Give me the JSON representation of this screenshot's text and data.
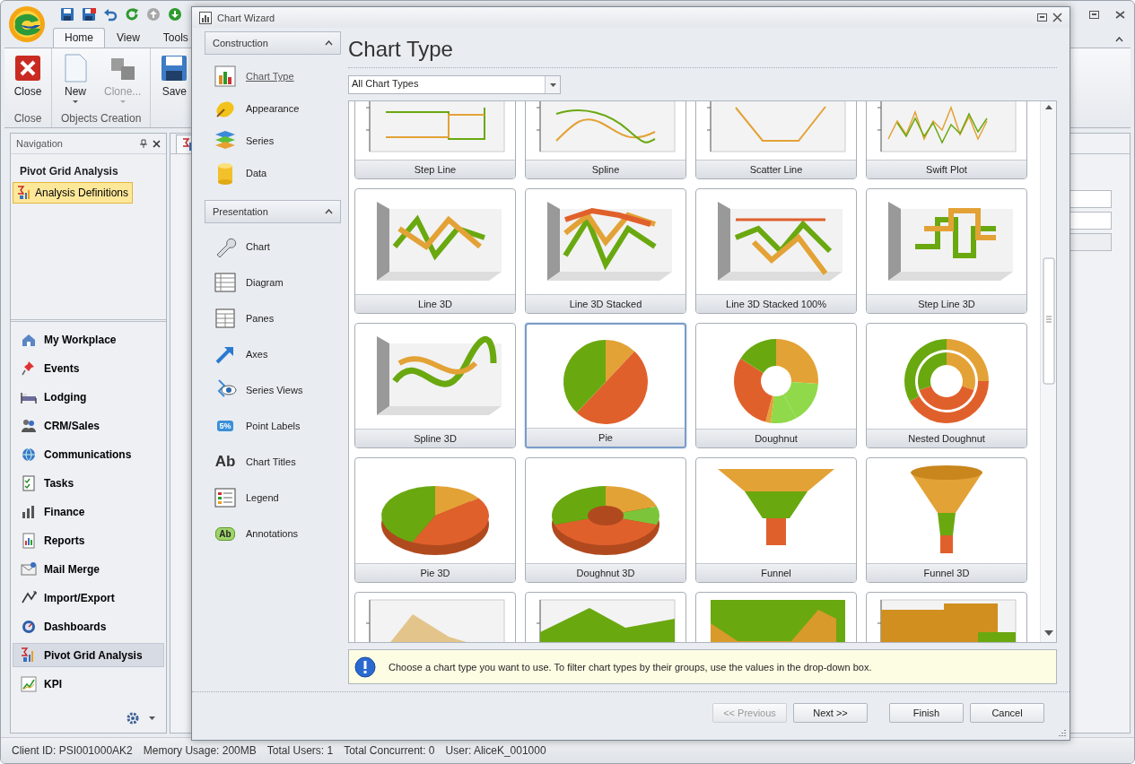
{
  "ribbon": {
    "tabs": [
      {
        "label": "Home",
        "selected": true
      },
      {
        "label": "View",
        "selected": false
      },
      {
        "label": "Tools",
        "selected": false
      }
    ],
    "groups": [
      {
        "label": "Close",
        "buttons": [
          {
            "label": "Close",
            "kind": "close",
            "disabled": false,
            "dropdown": false
          }
        ]
      },
      {
        "label": "Objects Creation",
        "buttons": [
          {
            "label": "New",
            "kind": "new",
            "disabled": false,
            "dropdown": true
          },
          {
            "label": "Clone...",
            "kind": "clone",
            "disabled": true,
            "dropdown": true
          }
        ]
      },
      {
        "buttons": [
          {
            "label": "Save",
            "kind": "save",
            "disabled": false,
            "dropdown": false
          }
        ]
      }
    ]
  },
  "navigation": {
    "title": "Navigation",
    "section": "Pivot Grid Analysis",
    "items": [
      {
        "label": "Analysis Definitions",
        "selected": true
      }
    ],
    "modules": [
      {
        "label": "My Workplace",
        "selected": false
      },
      {
        "label": "Events",
        "selected": false
      },
      {
        "label": "Lodging",
        "selected": false
      },
      {
        "label": "CRM/Sales",
        "selected": false
      },
      {
        "label": "Communications",
        "selected": false
      },
      {
        "label": "Tasks",
        "selected": false
      },
      {
        "label": "Finance",
        "selected": false
      },
      {
        "label": "Reports",
        "selected": false
      },
      {
        "label": "Mail Merge",
        "selected": false
      },
      {
        "label": "Import/Export",
        "selected": false
      },
      {
        "label": "Dashboards",
        "selected": false
      },
      {
        "label": "Pivot Grid Analysis",
        "selected": true
      },
      {
        "label": "KPI",
        "selected": false
      }
    ]
  },
  "status_bar": [
    "Client ID: PSI001000AK2",
    "Memory Usage: 200MB",
    "Total Users: 1",
    "Total Concurrent: 0",
    "User: AliceK_001000"
  ],
  "wizard": {
    "title": "Chart Wizard",
    "nav_groups": [
      {
        "title": "Construction",
        "expanded": true,
        "items": [
          {
            "label": "Chart Type",
            "selected": true
          },
          {
            "label": "Appearance",
            "selected": false
          },
          {
            "label": "Series",
            "selected": false
          },
          {
            "label": "Data",
            "selected": false
          }
        ]
      },
      {
        "title": "Presentation",
        "expanded": true,
        "items": [
          {
            "label": "Chart",
            "selected": false
          },
          {
            "label": "Diagram",
            "selected": false
          },
          {
            "label": "Panes",
            "selected": false
          },
          {
            "label": "Axes",
            "selected": false
          },
          {
            "label": "Series Views",
            "selected": false
          },
          {
            "label": "Point Labels",
            "selected": false,
            "icon_text": "5%"
          },
          {
            "label": "Chart Titles",
            "selected": false,
            "icon_text": "Ab"
          },
          {
            "label": "Legend",
            "selected": false
          },
          {
            "label": "Annotations",
            "selected": false,
            "icon_text": "Ab"
          }
        ]
      }
    ],
    "page_title": "Chart Type",
    "filter": {
      "value": "All Chart Types"
    },
    "chart_types": [
      {
        "label": "Step Line",
        "kind": "stepline",
        "selected": false
      },
      {
        "label": "Spline",
        "kind": "spline",
        "selected": false
      },
      {
        "label": "Scatter Line",
        "kind": "scatter",
        "selected": false
      },
      {
        "label": "Swift Plot",
        "kind": "swift",
        "selected": false
      },
      {
        "label": "Line 3D",
        "kind": "line3d",
        "selected": false
      },
      {
        "label": "Line 3D Stacked",
        "kind": "stacked3d",
        "selected": false
      },
      {
        "label": "Line 3D Stacked 100%",
        "kind": "full3d",
        "selected": false
      },
      {
        "label": "Step Line 3D",
        "kind": "step3d",
        "selected": false
      },
      {
        "label": "Spline 3D",
        "kind": "spline3d",
        "selected": false
      },
      {
        "label": "Pie",
        "kind": "pie",
        "selected": true
      },
      {
        "label": "Doughnut",
        "kind": "doughnut",
        "selected": false
      },
      {
        "label": "Nested Doughnut",
        "kind": "nested",
        "selected": false
      },
      {
        "label": "Pie 3D",
        "kind": "pie3d",
        "selected": false
      },
      {
        "label": "Doughnut 3D",
        "kind": "doughnut3d",
        "selected": false
      },
      {
        "label": "Funnel",
        "kind": "funnel",
        "selected": false
      },
      {
        "label": "Funnel 3D",
        "kind": "funnel3d",
        "selected": false
      },
      {
        "kind": "area",
        "selected": false
      },
      {
        "kind": "greenarea",
        "selected": false
      },
      {
        "kind": "fullarea",
        "selected": false
      },
      {
        "kind": "steparea",
        "selected": false
      }
    ],
    "info": "Choose a chart type you want to use. To filter chart types by their groups, use the values in the drop-down box.",
    "buttons": [
      {
        "label": "<< Previous",
        "disabled": true
      },
      {
        "label": "Next >>",
        "disabled": false
      },
      {
        "label": "Finish",
        "disabled": false
      },
      {
        "label": "Cancel",
        "disabled": false
      }
    ]
  }
}
